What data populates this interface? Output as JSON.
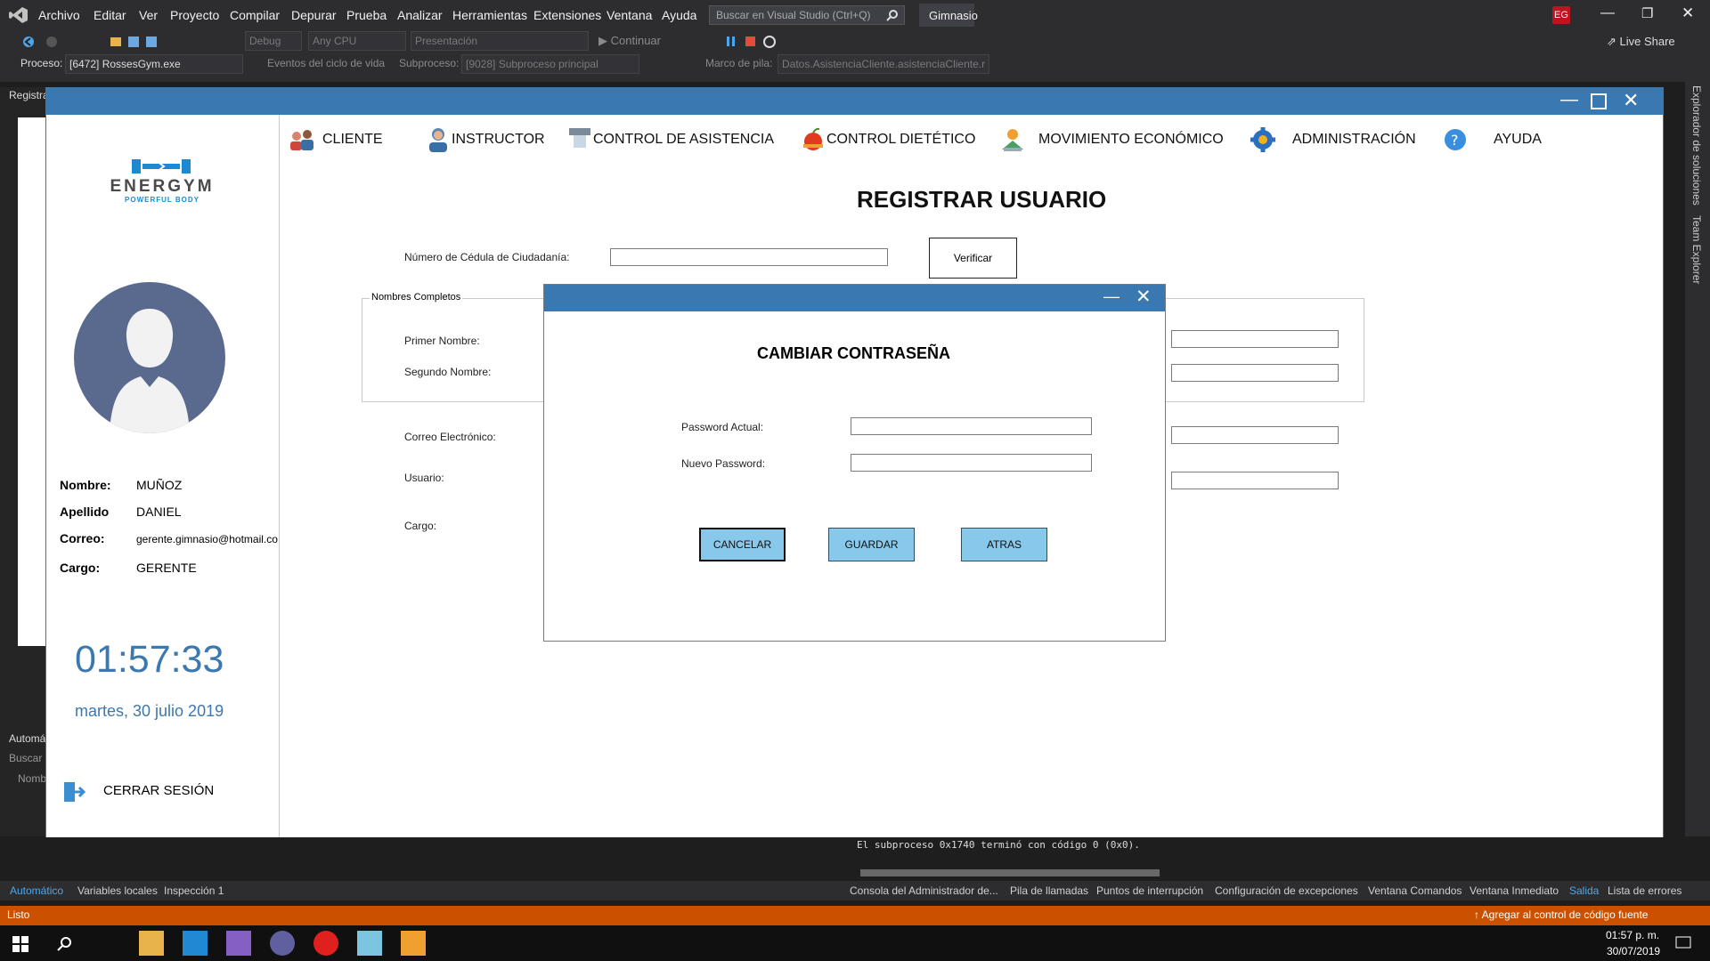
{
  "vs": {
    "menu": [
      "Archivo",
      "Editar",
      "Ver",
      "Proyecto",
      "Compilar",
      "Depurar",
      "Prueba",
      "Analizar",
      "Herramientas",
      "Extensiones",
      "Ventana",
      "Ayuda"
    ],
    "search_placeholder": "Buscar en Visual Studio (Ctrl+Q)",
    "solution_name": "Gimnasio",
    "user_badge": "EG",
    "live_share": "Live Share",
    "config": "Debug",
    "platform": "Any CPU",
    "presentation": "Presentación",
    "continue": "Continuar",
    "process_label": "Proceso:",
    "process_value": "[6472] RossesGym.exe",
    "lifecycle": "Eventos del ciclo de vida",
    "thread_label": "Subproceso:",
    "thread_value": "[9028] Subproceso principal",
    "stack_label": "Marco de pila:",
    "stack_value": "Datos.AsistenciaCliente.asistenciaCliente.r",
    "side_tab_text": "Registra",
    "auto_label": "Automá",
    "search_label": "Buscar",
    "name_label": "Nomb",
    "output_line": "El subproceso 0x1740 terminó con código 0 (0x0).",
    "right_strip": [
      "Explorador de soluciones",
      "Team Explorer"
    ],
    "bottom_tabs_left": [
      "Automático",
      "Variables locales",
      "Inspección 1"
    ],
    "bottom_tabs_right": [
      "Consola del Administrador de...",
      "Pila de llamadas",
      "Puntos de interrupción",
      "Configuración de excepciones",
      "Ventana Comandos",
      "Ventana Inmediato",
      "Salida",
      "Lista de errores"
    ],
    "status_left": "Listo",
    "status_right": "Agregar al control de código fuente",
    "taskbar_time": "01:57 p. m.",
    "taskbar_date": "30/07/2019"
  },
  "app": {
    "logo_text": "ENERGYM",
    "logo_sub": "POWERFUL BODY",
    "profile": [
      {
        "label": "Nombre:",
        "value": "MUÑOZ"
      },
      {
        "label": "Apellido",
        "value": "DANIEL"
      },
      {
        "label": "Correo:",
        "value": "gerente.gimnasio@hotmail.co"
      },
      {
        "label": "Cargo:",
        "value": "GERENTE"
      }
    ],
    "clock": "01:57:33",
    "date": "martes, 30 julio 2019",
    "logout": "CERRAR SESIÓN",
    "nav": [
      "CLIENTE",
      "INSTRUCTOR",
      "CONTROL DE ASISTENCIA",
      "CONTROL DIETÉTICO",
      "MOVIMIENTO ECONÓMICO",
      "ADMINISTRACIÓN",
      "AYUDA"
    ],
    "page_title": "REGISTRAR USUARIO",
    "cedula_label": "Número de Cédula de Ciudadanía:",
    "verify_button": "Verificar",
    "group_names": "Nombres Completos",
    "first_name_label": "Primer Nombre:",
    "second_name_label": "Segundo Nombre:",
    "email_label": "Correo Electrónico:",
    "user_label": "Usuario:",
    "role_label": "Cargo:"
  },
  "dialog": {
    "title": "CAMBIAR CONTRASEÑA",
    "current_label": "Password Actual:",
    "new_label": "Nuevo Password:",
    "cancel": "CANCELAR",
    "save": "GUARDAR",
    "back": "ATRAS"
  },
  "colors": {
    "accent_blue": "#3a78b2",
    "button_fill": "#88c8ea",
    "clock_blue": "#3b78b0",
    "status_orange": "#ca5100"
  }
}
